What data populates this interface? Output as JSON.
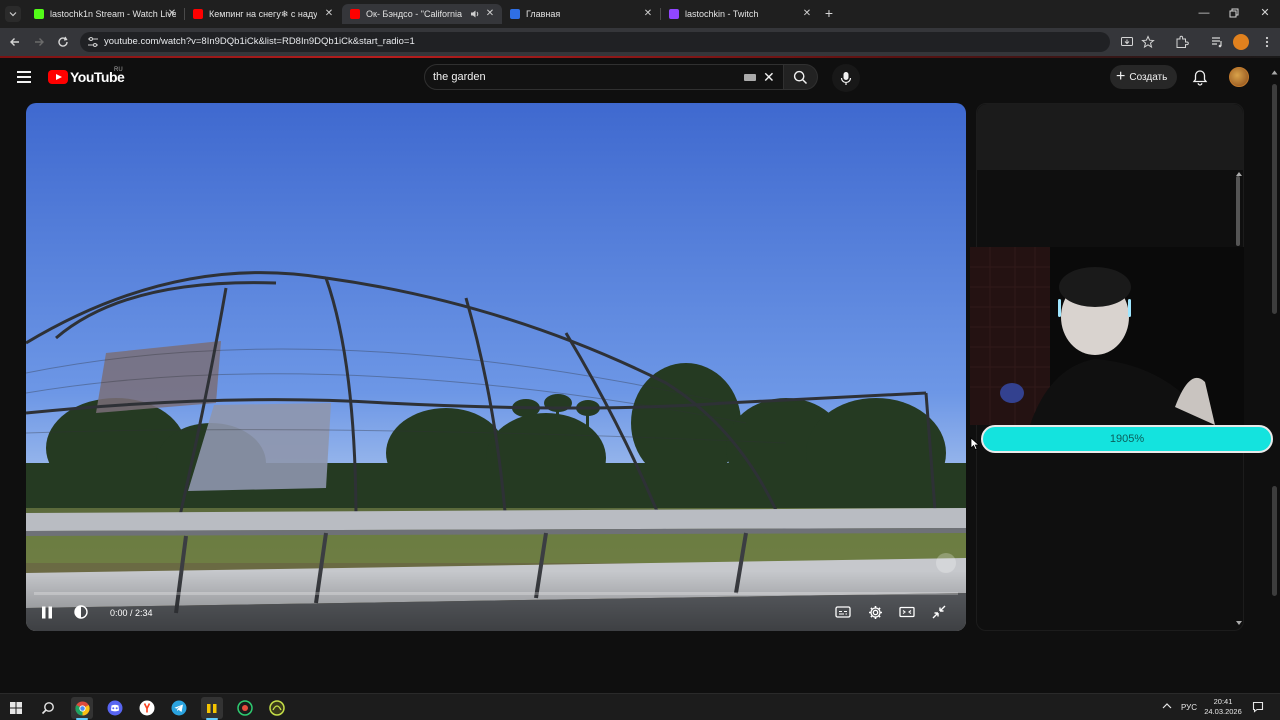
{
  "browser": {
    "tabs": [
      {
        "title": "lastochk1n Stream - Watch Live",
        "favicon_color": "#53fc18",
        "active": false
      },
      {
        "title": "Кемпинг на снегу❄ с надувн",
        "favicon_color": "#ff0000",
        "active": false
      },
      {
        "title": "Ок- Бэндсо - \"California Il",
        "favicon_color": "#ff0000",
        "active": true,
        "audio": true
      },
      {
        "title": "Главная",
        "favicon_color": "#2f6fe4",
        "active": false
      },
      {
        "title": "lastochkin - Twitch",
        "favicon_color": "#9146ff",
        "active": false
      }
    ],
    "url": "youtube.com/watch?v=8In9DQb1iCk&list=RD8In9DQb1iCk&start_radio=1",
    "profile_color": "#e0811e"
  },
  "youtube": {
    "logo_text": "YouTube",
    "region": "RU",
    "search": {
      "value": "the garden"
    },
    "create_label": "Создать"
  },
  "player": {
    "current_time": "0:00",
    "duration": "2:34",
    "time_display": "0:00 / 2:34",
    "progress": 0,
    "state": "playing"
  },
  "overlay": {
    "donation_bar_text": "1905%",
    "donation_bar_color": "#14e3de"
  },
  "taskbar": {
    "apps": [
      "windows-start",
      "search",
      "chrome",
      "discord",
      "yandex-browser",
      "telegram",
      "app-yellow",
      "app-green",
      "app-lime"
    ],
    "language": "РУС",
    "time": "20:41",
    "date": "24.03.2026"
  }
}
